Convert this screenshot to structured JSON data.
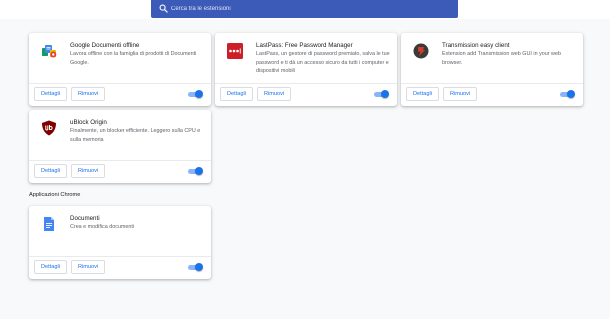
{
  "search": {
    "placeholder": "Cerca tra le estensioni"
  },
  "buttons": {
    "details": "Dettagli",
    "remove": "Rimuovi"
  },
  "extensions": [
    {
      "name": "Google Documenti offline",
      "description": "Lavora offline con la famiglia di prodotti di Documenti Google.",
      "icon": "google-docs-offline-icon",
      "enabled": true
    },
    {
      "name": "LastPass: Free Password Manager",
      "description": "LastPass, un gestore di password premiato, salva le tue password e ti dà un accesso sicuro da tutti i computer e dispositivi mobili",
      "icon": "lastpass-icon",
      "enabled": true
    },
    {
      "name": "Transmission easy client",
      "description": "Extension add Transmission web GUI in your web browser.",
      "icon": "transmission-icon",
      "enabled": true
    },
    {
      "name": "uBlock Origin",
      "description": "Finalmente, un blocker efficiente. Leggero sulla CPU e sulla memoria",
      "icon": "ublock-origin-icon",
      "enabled": true
    }
  ],
  "chrome_apps": {
    "section_title": "Applicazioni Chrome",
    "items": [
      {
        "name": "Documenti",
        "description": "Crea e modifica documenti",
        "icon": "google-docs-icon",
        "enabled": true
      }
    ]
  },
  "colors": {
    "search_bar": "#3c5bb8",
    "accent": "#1a73e8",
    "toggle_track": "#8ab4f8",
    "lastpass": "#cc2029",
    "ublock": "#800000",
    "docs": "#4285f4"
  }
}
